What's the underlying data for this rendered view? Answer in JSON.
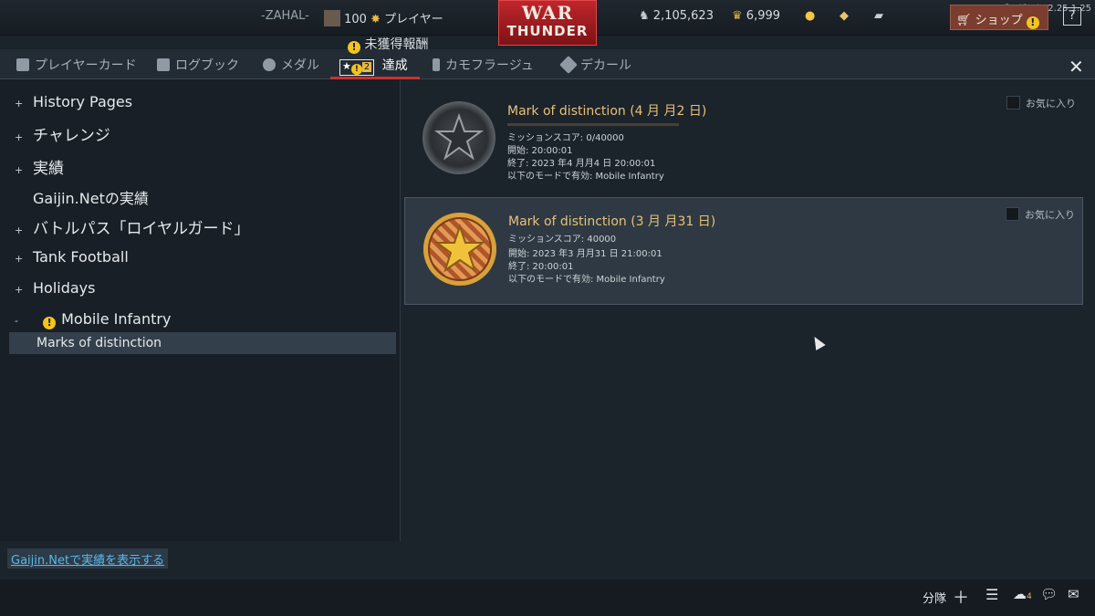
{
  "version": "バージョン 2.25.1.25",
  "topbar": {
    "nickname": "-ZAHAL-",
    "level": "100",
    "rank_label": "プレイヤー",
    "unreceived_rewards": "未獲得報酬",
    "logo_line1": "WAR",
    "logo_line2": "THUNDER",
    "silver_lions": "2,105,623",
    "golden_eagles": "6,999",
    "shop_label": "ショップ",
    "help_label": "?"
  },
  "tabs": [
    {
      "label": "プレイヤーカード",
      "icon": "player-card-icon"
    },
    {
      "label": "ログブック",
      "icon": "logbook-icon"
    },
    {
      "label": "メダル",
      "icon": "medal-icon"
    },
    {
      "label": "達成",
      "icon": "achievement-star-icon",
      "badge": "2",
      "active": true
    },
    {
      "label": "カモフラージュ",
      "icon": "brush-icon"
    },
    {
      "label": "デカール",
      "icon": "decal-icon"
    }
  ],
  "tree": [
    {
      "label": "History Pages",
      "marker": "+"
    },
    {
      "label": "チャレンジ",
      "marker": "+"
    },
    {
      "label": "実績",
      "marker": "+"
    },
    {
      "label": "Gaijin.Netの実績",
      "marker": ""
    },
    {
      "label": "バトルパス「ロイヤルガード」",
      "marker": "+"
    },
    {
      "label": "Tank Football",
      "marker": "+"
    },
    {
      "label": "Holidays",
      "marker": "+"
    },
    {
      "label": "Mobile Infantry",
      "marker": "-",
      "warning": true
    }
  ],
  "tree_selected_child": "Marks of distinction",
  "cards": [
    {
      "title": "Mark of distinction (4 月 月2 日)",
      "score": "ミッションスコア: 0/40000",
      "progress": 0,
      "start": "開始: 20:00:01",
      "end": "終了: 2023 年4 月月4 日 20:00:01",
      "mode": "以下のモードで有効: Mobile Infantry",
      "favorite_label": "お気に入り",
      "medal": "silver-star-medal"
    },
    {
      "title": "Mark of distinction (3 月 月31 日)",
      "score": "ミッションスコア: 40000",
      "start": "開始: 2023 年3 月月31 日 21:00:01",
      "end": "終了: 20:00:01",
      "mode": "以下のモードで有効: Mobile Infantry",
      "favorite_label": "お気に入り",
      "medal": "gold-star-medal"
    }
  ],
  "footer": {
    "gaijin_link": "Gaijin.Netで実績を表示する",
    "squad_label": "分隊",
    "contacts_count": "4"
  }
}
